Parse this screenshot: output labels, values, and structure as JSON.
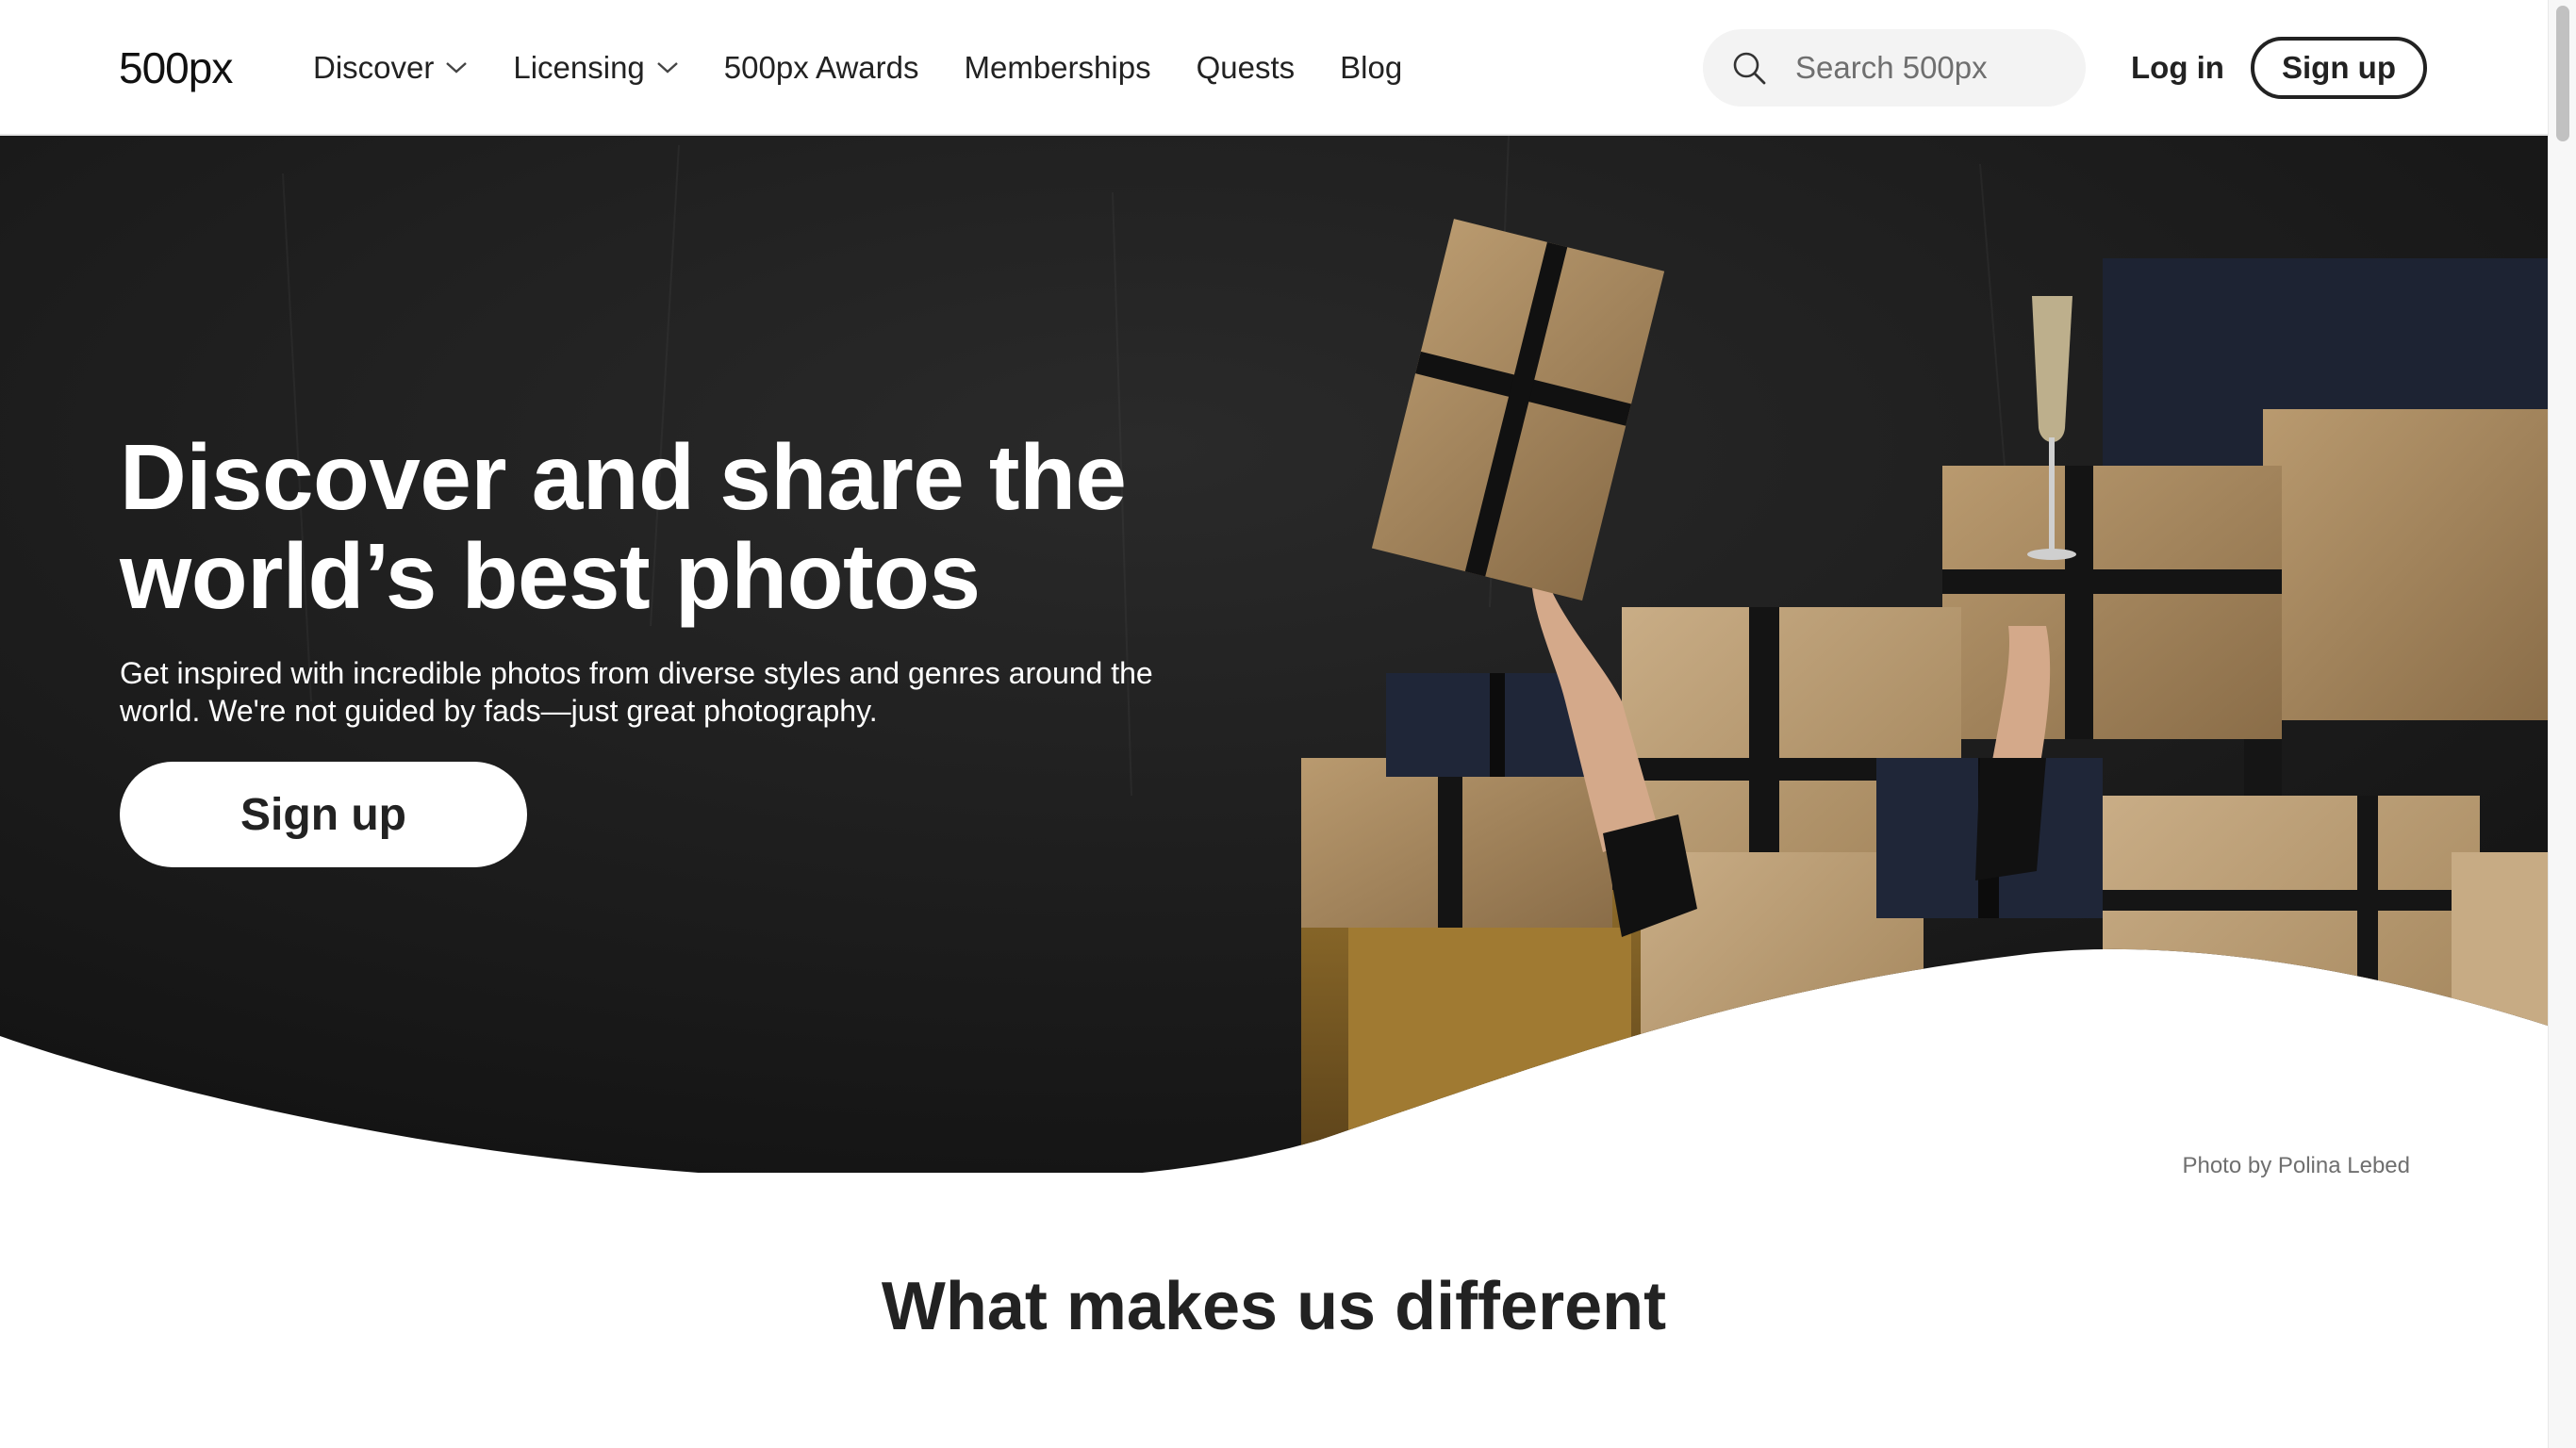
{
  "header": {
    "logo_text": "500px",
    "nav": [
      {
        "label": "Discover",
        "has_dropdown": true
      },
      {
        "label": "Licensing",
        "has_dropdown": true
      },
      {
        "label": "500px Awards",
        "has_dropdown": false
      },
      {
        "label": "Memberships",
        "has_dropdown": false
      },
      {
        "label": "Quests",
        "has_dropdown": false
      },
      {
        "label": "Blog",
        "has_dropdown": false
      }
    ],
    "search": {
      "placeholder": "Search 500px",
      "value": "",
      "icon": "search-icon"
    },
    "login_label": "Log in",
    "signup_label": "Sign up"
  },
  "hero": {
    "title_line1": "Discover and share the",
    "title_line2": "world’s best photos",
    "subtitle": "Get inspired with incredible photos from diverse styles and genres around the world. We're not guided by fads—just great photography.",
    "signup_label": "Sign up",
    "photo_credit": "Photo by Polina Lebed"
  },
  "section": {
    "title": "What makes us different"
  },
  "colors": {
    "brand_dark": "#222222",
    "hero_bg": "#161616",
    "kraft_paper": "#a88a62",
    "navy_wrap": "#1f2638"
  }
}
